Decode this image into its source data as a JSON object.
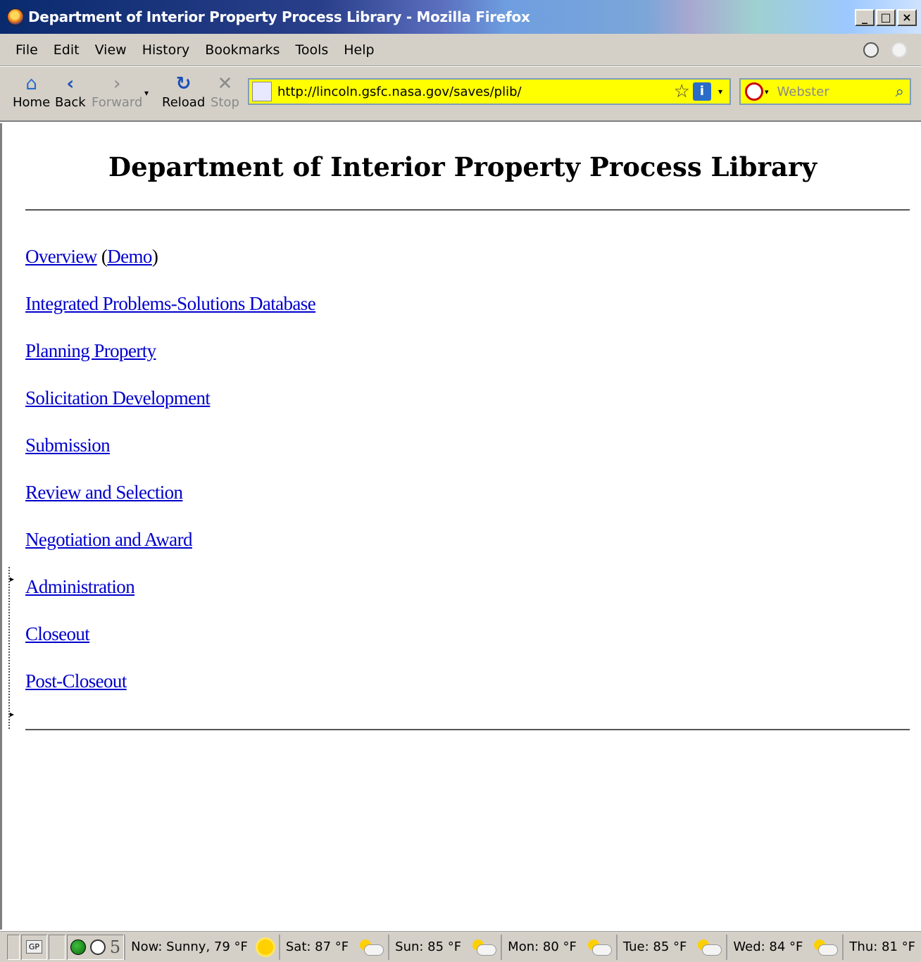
{
  "window": {
    "title": "Department of Interior Property Process Library - Mozilla Firefox",
    "controls": [
      "_",
      "□",
      "×"
    ]
  },
  "menu": [
    "File",
    "Edit",
    "View",
    "History",
    "Bookmarks",
    "Tools",
    "Help"
  ],
  "nav": {
    "home": "Home",
    "back": "Back",
    "forward": "Forward",
    "reload": "Reload",
    "stop": "Stop",
    "url": "http://lincoln.gsfc.nasa.gov/saves/plib/",
    "search_placeholder": "Webster"
  },
  "page": {
    "heading": "Department of Interior Property Process Library",
    "overview": "Overview",
    "demo": "Demo",
    "links": [
      "Integrated Problems-Solutions Database",
      "Planning Property",
      "Solicitation Development",
      "Submission",
      "Review and Selection",
      "Negotiation and Award",
      "Administration",
      "Closeout",
      "Post-Closeout"
    ]
  },
  "status": {
    "gp": "GP",
    "counter": "5",
    "weather": [
      "Now: Sunny, 79 °F",
      "Sat: 87 °F",
      "Sun: 85 °F",
      "Mon: 80 °F",
      "Tue: 85 °F",
      "Wed: 84 °F",
      "Thu: 81 °F"
    ]
  },
  "icons": {
    "title": "firefox-icon",
    "home": "house-icon",
    "back": "left-arrow-icon",
    "forward": "right-arrow-icon",
    "reload": "reload-icon",
    "stop": "x-icon",
    "bookmark": "star-icon",
    "search": "magnifier-icon"
  }
}
